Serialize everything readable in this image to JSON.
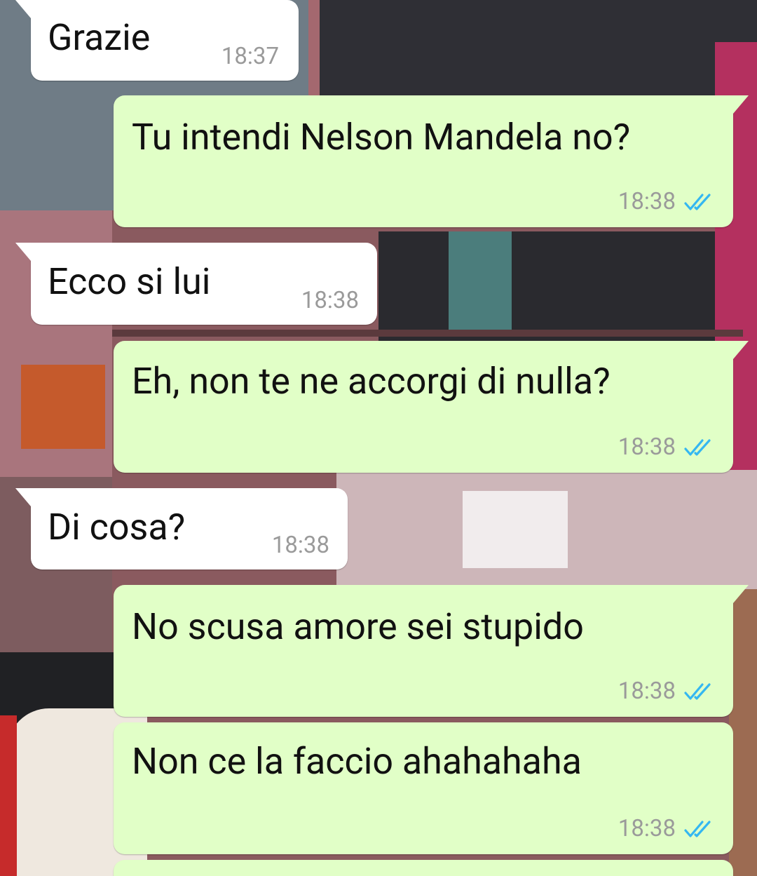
{
  "colors": {
    "incoming_bubble": "#ffffff",
    "outgoing_bubble": "#e1ffc7",
    "timestamp": "#9a9a9a",
    "read_ticks": "#34b7f1"
  },
  "messages": [
    {
      "direction": "incoming",
      "text": "Grazie",
      "time": "18:37"
    },
    {
      "direction": "outgoing",
      "text": "Tu intendi Nelson Mandela no?",
      "time": "18:38",
      "status_icon": "double-check-read-icon"
    },
    {
      "direction": "incoming",
      "text": "Ecco si lui",
      "time": "18:38"
    },
    {
      "direction": "outgoing",
      "text": "Eh, non te ne accorgi di nulla?",
      "time": "18:38",
      "status_icon": "double-check-read-icon"
    },
    {
      "direction": "incoming",
      "text": "Di cosa?",
      "time": "18:38"
    },
    {
      "direction": "outgoing",
      "text": "No scusa amore sei stupido",
      "time": "18:38",
      "status_icon": "double-check-read-icon"
    },
    {
      "direction": "outgoing",
      "text": "Non ce la faccio ahahahaha",
      "time": "18:38",
      "status_icon": "double-check-read-icon"
    }
  ]
}
